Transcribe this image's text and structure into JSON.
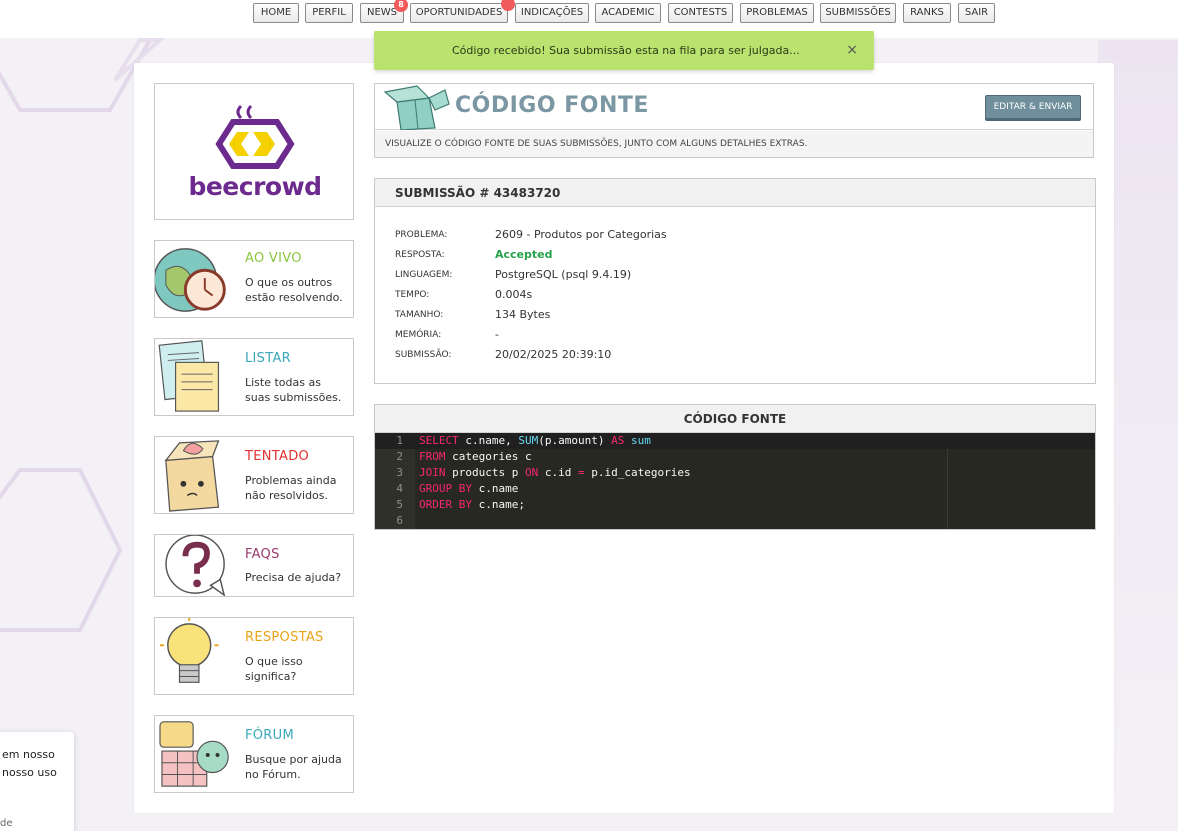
{
  "nav": {
    "items": [
      "HOME",
      "PERFIL",
      "NEWS",
      "OPORTUNIDADES",
      "INDICAÇÕES",
      "ACADEMIC",
      "CONTESTS",
      "PROBLEMAS",
      "SUBMISSÕES",
      "RANKS",
      "SAIR"
    ],
    "news_badge": "8"
  },
  "toast": {
    "message": "Código recebido! Sua submissão esta na fila para ser julgada...",
    "close": "×"
  },
  "logo": {
    "text": "beecrowd"
  },
  "sidebar": [
    {
      "title": "AO VIVO",
      "desc": "O que os outros estão resolvendo.",
      "color": "#8cc63f",
      "icon": "globe-clock-icon"
    },
    {
      "title": "LISTAR",
      "desc": "Liste todas as suas submissões.",
      "color": "#3aa8b8",
      "icon": "papers-icon"
    },
    {
      "title": "TENTADO",
      "desc": "Problemas ainda não resolvidos.",
      "color": "#e03030",
      "icon": "box-face-icon"
    },
    {
      "title": "FAQS",
      "desc": "Precisa de ajuda?",
      "color": "#9b3a6e",
      "icon": "question-bubble-icon"
    },
    {
      "title": "RESPOSTAS",
      "desc": "O que isso significa?",
      "color": "#e8a317",
      "icon": "lightbulb-icon"
    },
    {
      "title": "FÓRUM",
      "desc": "Busque por ajuda no Fórum.",
      "color": "#3aa8b8",
      "icon": "forum-icon"
    }
  ],
  "header": {
    "title": "CÓDIGO FONTE",
    "edit_button": "EDITAR & ENVIAR",
    "description": "VISUALIZE O CÓDIGO FONTE DE SUAS SUBMISSÕES, JUNTO COM ALGUNS DETALHES EXTRAS."
  },
  "submission": {
    "title": "SUBMISSÃO # 43483720",
    "rows": [
      {
        "key": "PROBLEMA:",
        "value": "2609 - Produtos por Categorias"
      },
      {
        "key": "RESPOSTA:",
        "value": "Accepted"
      },
      {
        "key": "LINGUAGEM:",
        "value": "PostgreSQL (psql 9.4.19)"
      },
      {
        "key": "TEMPO:",
        "value": "0.004s"
      },
      {
        "key": "TAMANHO:",
        "value": "134 Bytes"
      },
      {
        "key": "MEMÓRIA:",
        "value": "-"
      },
      {
        "key": "SUBMISSÃO:",
        "value": "20/02/2025 20:39:10"
      }
    ]
  },
  "code": {
    "title": "CÓDIGO FONTE",
    "lines": [
      "SELECT c.name, SUM(p.amount) AS sum",
      "FROM categories c",
      "JOIN products p ON c.id = p.id_categories",
      "GROUP BY c.name",
      "ORDER BY c.name;",
      ""
    ]
  },
  "cookie": {
    "line1": "em nosso",
    "line2": "nosso uso",
    "line3": "de"
  }
}
